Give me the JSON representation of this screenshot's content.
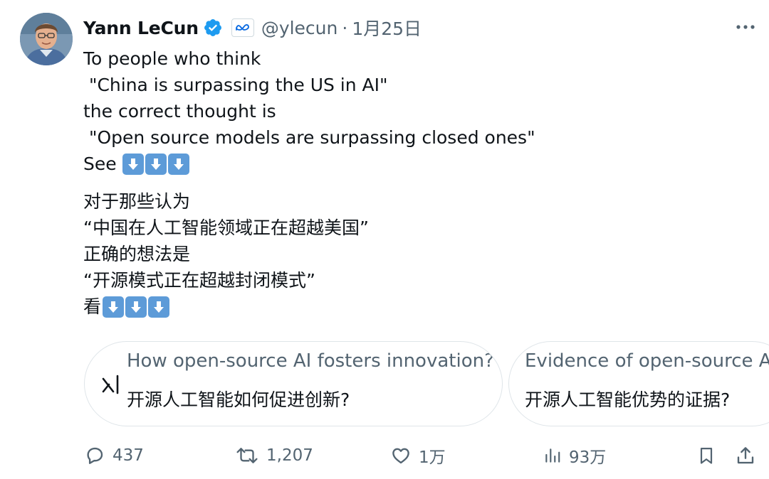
{
  "author": {
    "name": "Yann LeCun",
    "handle": "@ylecun",
    "separator": "·",
    "date": "1月25日",
    "verified": true,
    "affiliation_icon": "meta-logo-icon"
  },
  "tweet": {
    "english_lines": [
      "To people who think",
      " \"China is surpassing the US in AI\"",
      "the correct thought is",
      " \"Open source models are surpassing closed ones\"",
      "See"
    ],
    "chinese_lines": [
      "对于那些认为",
      "“中国在人工智能领域正在超越美国”",
      "正确的想法是",
      "“开源模式正在超越封闭模式”",
      "看"
    ],
    "emoji": "down-arrow-icon",
    "emoji_count": 3
  },
  "grok_cards": [
    {
      "question": "How open-source AI fosters innovation?",
      "answer": "开源人工智能如何促进创新?",
      "icon": "grok-logo-icon"
    },
    {
      "question": "Evidence of open-source AI advantages",
      "answer": "开源人工智能优势的证据?"
    }
  ],
  "actions": {
    "replies": "437",
    "retweets": "1,207",
    "likes": "1万",
    "views": "93万"
  },
  "colors": {
    "text": "#0f1419",
    "secondary": "#536471",
    "verified_blue": "#1d9bf0",
    "emoji_blue": "#5d9bd8",
    "border": "#dfe5e9"
  }
}
